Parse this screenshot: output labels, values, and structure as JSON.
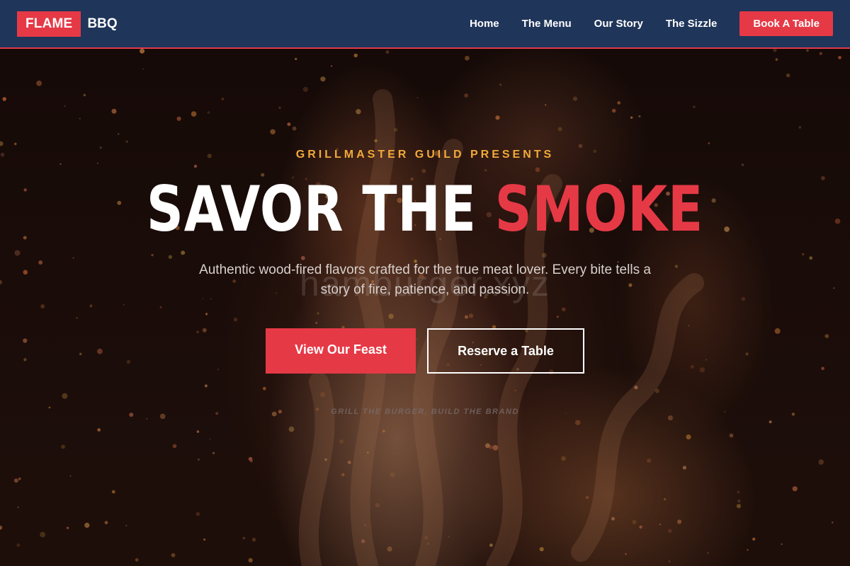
{
  "header": {
    "logo_highlight": "FLAME",
    "logo_text": "BBQ",
    "nav": [
      {
        "label": "Home"
      },
      {
        "label": "The Menu"
      },
      {
        "label": "Our Story"
      },
      {
        "label": "The Sizzle"
      }
    ],
    "cta_label": "Book A Table"
  },
  "hero": {
    "eyebrow": "GRILLMASTER GUILD PRESENTS",
    "headline_main": "SAVOR THE",
    "headline_accent": "SMOKE",
    "subtext": "Authentic wood-fired flavors crafted for the true meat lover. Every bite tells a story of fire, patience, and passion.",
    "watermark": "hamburger.xyz",
    "primary_button": "View Our Feast",
    "secondary_button": "Reserve a Table",
    "tagline": "GRILL THE BURGER, BUILD THE BRAND"
  },
  "colors": {
    "brand_red": "#e63946",
    "header_navy": "#1f355a",
    "eyebrow_gold": "#f2a93b"
  },
  "background": {
    "description_icon": "fire-embers-icon"
  }
}
